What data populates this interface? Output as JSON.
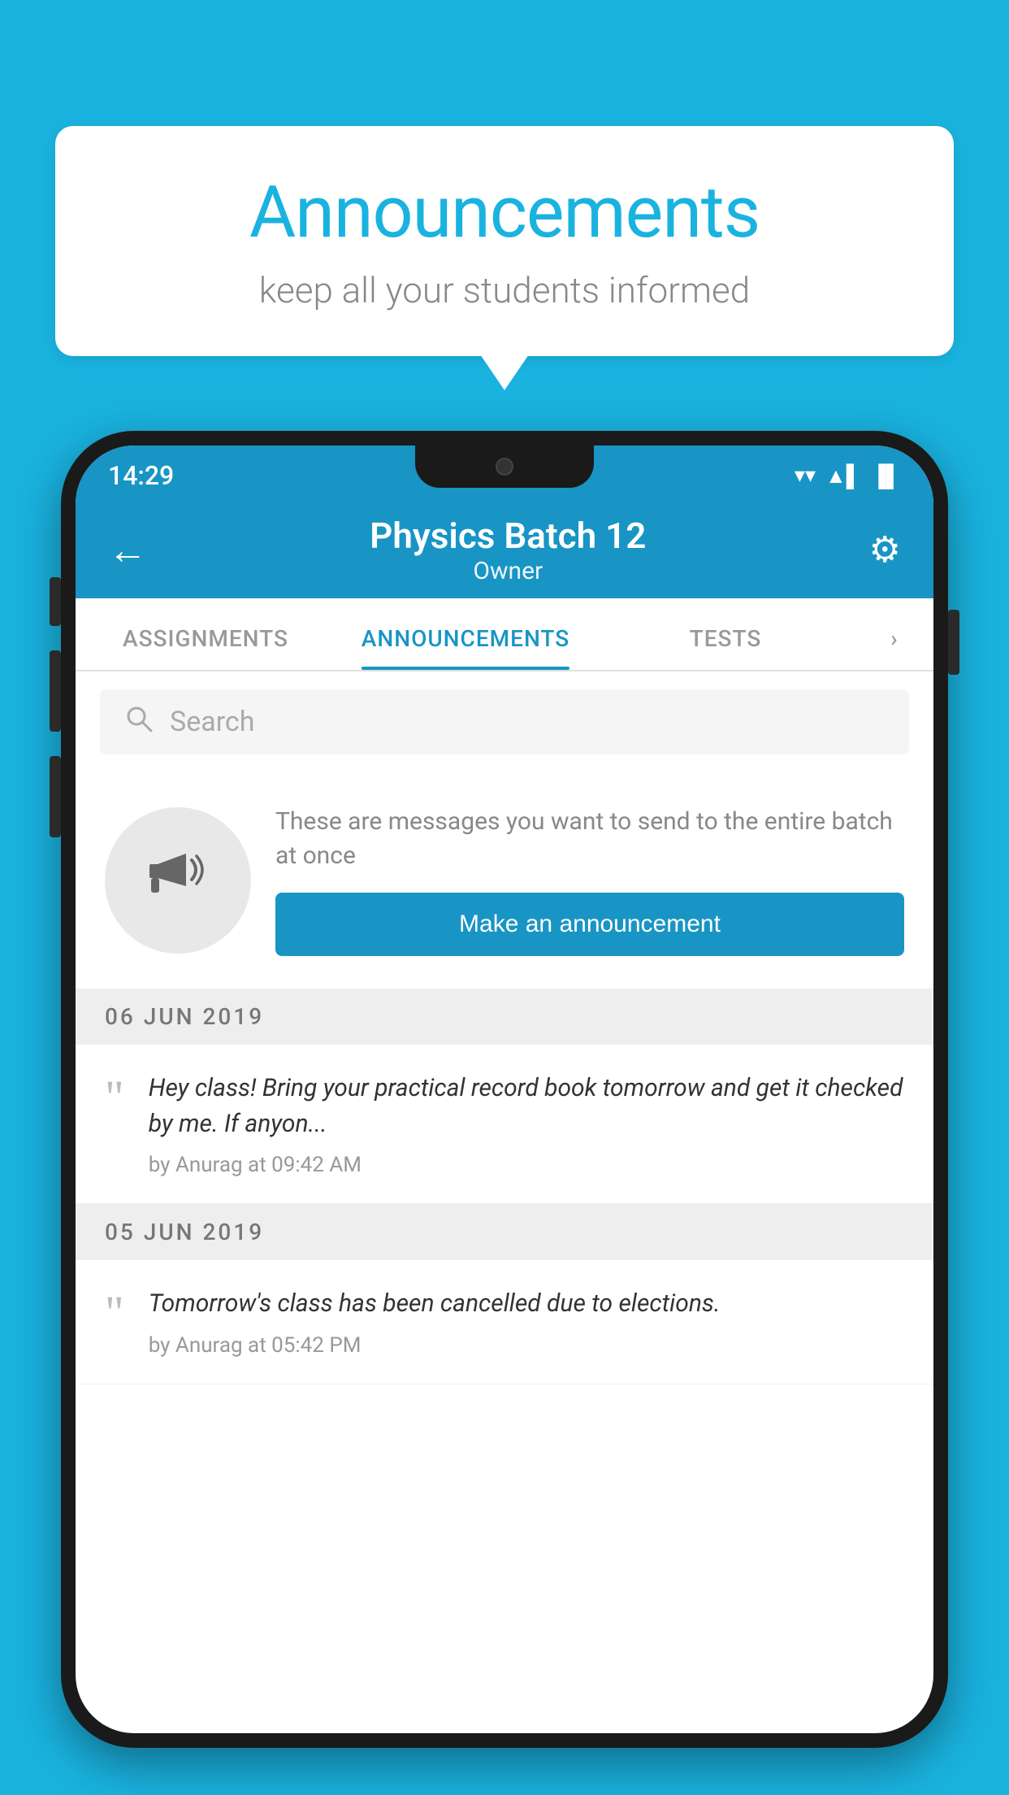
{
  "background_color": "#1ab3e0",
  "speech_bubble": {
    "title": "Announcements",
    "subtitle": "keep all your students informed"
  },
  "phone": {
    "status_bar": {
      "time": "14:29",
      "wifi": "▼",
      "signal": "▲",
      "battery": "▐"
    },
    "header": {
      "title": "Physics Batch 12",
      "subtitle": "Owner",
      "back_label": "←",
      "settings_label": "⚙"
    },
    "tabs": [
      {
        "label": "ASSIGNMENTS",
        "active": false
      },
      {
        "label": "ANNOUNCEMENTS",
        "active": true
      },
      {
        "label": "TESTS",
        "active": false
      }
    ],
    "search": {
      "placeholder": "Search"
    },
    "promo": {
      "description": "These are messages you want to send to the entire batch at once",
      "button_label": "Make an announcement"
    },
    "announcements": [
      {
        "date": "06  JUN  2019",
        "text": "Hey class! Bring your practical record book tomorrow and get it checked by me. If anyon...",
        "meta": "by Anurag at 09:42 AM"
      },
      {
        "date": "05  JUN  2019",
        "text": "Tomorrow's class has been cancelled due to elections.",
        "meta": "by Anurag at 05:42 PM"
      }
    ]
  }
}
